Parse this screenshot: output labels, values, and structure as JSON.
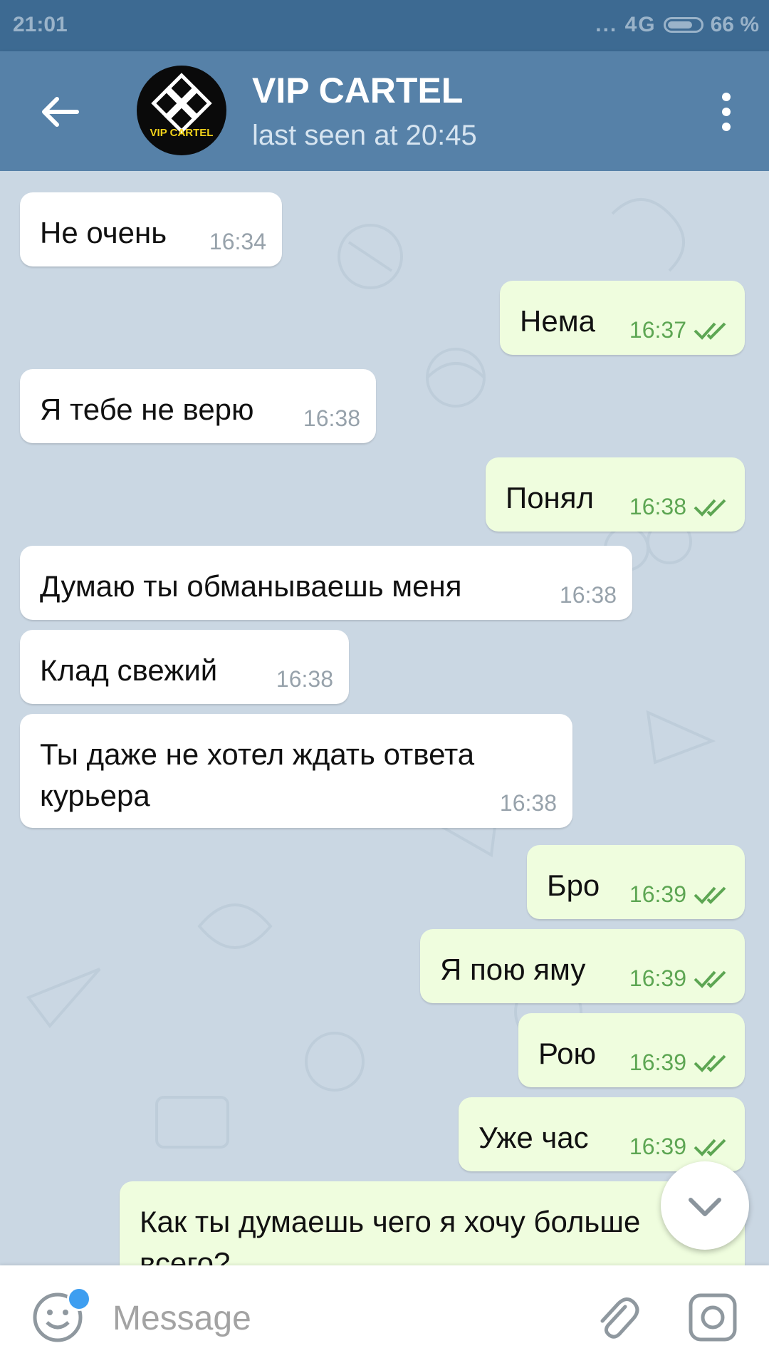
{
  "status_bar": {
    "time": "21:01",
    "signal": "... 4G",
    "battery": "66 %"
  },
  "header": {
    "avatar_brand": "VIP CARTEL",
    "title": "VIP CARTEL",
    "subtitle": "last seen at 20:45",
    "icons": {
      "back": "arrow-left-icon",
      "menu": "more-vertical-icon"
    }
  },
  "messages": [
    {
      "dir": "in",
      "text": "Не очень",
      "time": "16:34"
    },
    {
      "dir": "out",
      "text": "Нема",
      "time": "16:37",
      "read": true
    },
    {
      "dir": "in",
      "text": "Я тебе не верю",
      "time": "16:38"
    },
    {
      "dir": "out",
      "text": "Понял",
      "time": "16:38",
      "read": true
    },
    {
      "dir": "in",
      "text": "Думаю ты обманываешь меня",
      "time": "16:38"
    },
    {
      "dir": "in",
      "text": "Клад свежий",
      "time": "16:38"
    },
    {
      "dir": "in",
      "text": "Ты даже не хотел ждать ответа курьера",
      "time": "16:38"
    },
    {
      "dir": "out",
      "text": "Бро",
      "time": "16:39",
      "read": true
    },
    {
      "dir": "out",
      "text": "Я пою яму",
      "time": "16:39",
      "read": true
    },
    {
      "dir": "out",
      "text": "Рою",
      "time": "16:39",
      "read": true
    },
    {
      "dir": "out",
      "text": "Уже час",
      "time": "16:39",
      "read": true
    },
    {
      "dir": "out",
      "text": "Как ты думаешь чего я хочу больше всего?",
      "time": ""
    }
  ],
  "input": {
    "placeholder": "Message",
    "value": ""
  },
  "input_icons": {
    "emoji": "emoji-icon",
    "attach": "paperclip-icon",
    "camera": "camera-icon",
    "scroll": "chevron-down-icon"
  },
  "colors": {
    "header": "#5681a8",
    "status_bar": "#3d6a92",
    "incoming": "#ffffff",
    "outgoing": "#effdde",
    "out_time": "#5da653",
    "badge": "#3e9ef0"
  }
}
